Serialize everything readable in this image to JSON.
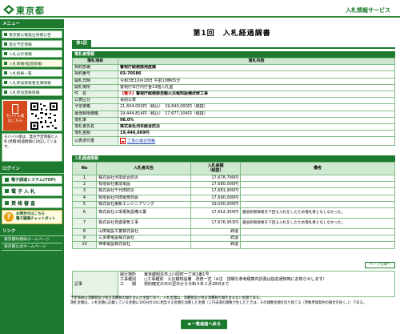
{
  "header": {
    "logo_text": "東京都",
    "service_title": "入札情報サービス"
  },
  "sidebar": {
    "menu_heading": "メニュー",
    "items": [
      {
        "label": "東京都公報発注情報公告",
        "selected": false
      },
      {
        "label": "発注予定情報",
        "selected": false
      },
      {
        "label": "入札公示情報",
        "selected": false
      },
      {
        "label": "入札情報(経過情報)",
        "selected": true
      },
      {
        "label": "入札結果一覧",
        "selected": false
      },
      {
        "label": "入札参加資格者名簿情報",
        "selected": false
      },
      {
        "label": "入札参加資格情報",
        "selected": false
      }
    ],
    "mobile_label": "モバイル版",
    "mobile_sub": "はこちら",
    "mobile_note": "モバイル版は、発注予定情報と入札(見積)経過情報に対応しています。",
    "links_heading": "ログイン",
    "links": [
      {
        "label": "電子調達システム(TOP)",
        "big": false
      },
      {
        "label": "電子入札",
        "big": true
      },
      {
        "label": "資格審査",
        "big": true
      }
    ],
    "help_title": "お問合せはこちら",
    "help_sub": "電子調達チャットボット",
    "plain_heading": "リンク",
    "plain_links": [
      "東京都財務局ホームページ",
      "東京都公式ホームページ"
    ]
  },
  "main": {
    "page_title": "第1回　入札経過調書",
    "tab_label": "第1回"
  },
  "overview": {
    "section_title": "落札者情報",
    "col_item": "落札項目",
    "col_content": "落札内容",
    "rows": [
      {
        "label": "契約部署",
        "value": "警視庁総務部用度課",
        "bold": true
      },
      {
        "label": "契約番号",
        "value": "03-70586",
        "bold": true
      },
      {
        "label": "開札日時",
        "value": "令和3年10月18日 午前10時05分",
        "bold": false
      },
      {
        "label": "開札場所",
        "value": "警視庁本庁内庁舎13階入札室",
        "bold": false
      },
      {
        "label": "件　名",
        "tag": "【電子】",
        "value": "警視庁総務部自動火災報知設備改修工事",
        "bold": true
      },
      {
        "label": "公表区分",
        "value": "事前公表",
        "bold": false
      },
      {
        "label": "予定価格",
        "value": "21,604,000円（税込）　19,640,000円（税抜）",
        "bold": false
      },
      {
        "label": "最低制限価格",
        "value": "19,444,814円（税込）　17,677,104円（税抜）",
        "bold": false
      },
      {
        "label": "落札率",
        "value": "98.0%",
        "bold": true
      },
      {
        "label": "落札者氏名",
        "value": "株式会社河本総合防災",
        "bold": true
      },
      {
        "label": "落札金額",
        "value": "19,446,669円",
        "bold": true
      }
    ],
    "doc_label": "公表添付書",
    "doc_link": "工事の場合情報"
  },
  "progress": {
    "section_title": "入札経過情報",
    "col_no": "No",
    "col_name": "入札者氏名",
    "col_amount": "入札金額\n（税抜）",
    "col_note": "備考",
    "rows": [
      {
        "no": "1",
        "name": "株式会社河本総合防災",
        "amount": "17,678,790円",
        "note": ""
      },
      {
        "no": "2",
        "name": "有限会社東成電設",
        "amount": "17,680,000円",
        "note": ""
      },
      {
        "no": "3",
        "name": "株式会社千代田防災",
        "amount": "17,681,900円",
        "note": ""
      },
      {
        "no": "4",
        "name": "有限会社内田電気商会",
        "amount": "17,690,000円",
        "note": ""
      },
      {
        "no": "5",
        "name": "株式会社東新エンジニアリング",
        "amount": "19,000,000円",
        "note": ""
      },
      {
        "no": "6",
        "name": "株式会社三栄電気設備工業",
        "amount": "17,652,350円",
        "note": "最低制限価格を下回る入札をしたため落札者となしなかった。"
      },
      {
        "no": "7",
        "name": "株式会社見盛電気工事",
        "amount": "17,676,953円",
        "note": "最低制限価格を下回る入札をしたため落札者となしなかった。"
      },
      {
        "no": "8",
        "name": "山田電設工業株式会社",
        "amount": "辞退",
        "note": ""
      },
      {
        "no": "9",
        "name": "三多摩電設株式会社",
        "amount": "辞退",
        "note": ""
      },
      {
        "no": "10",
        "name": "神幸電設株式会社",
        "amount": "辞退",
        "note": ""
      }
    ],
    "to_top": "ページ先頭へ"
  },
  "remarks": {
    "label": "記事",
    "lines": [
      "履行場所　　東京都昭島市上川原町一丁目1番1号",
      "工事種別　　○工事種別　火災報知設備　改修一式（※注　詳細な参考積算内訳書は指名通知時にお知らせします）",
      "工　　期　　契約確定の日の翌日から令和４年２月28日まで"
    ]
  },
  "footnotes": [
    "予定価格は消費税及び地方消費税の額を含んだ金額であり、入札金額は、消費税及び地方消費税の額を含まない金額である。",
    "落札金額は、入札金額に記載している金額に100分の10に相当する金額を加算した金額（１円未満の端数が生じたときは、その端数金額を切り捨てる（単数単価契約の場合を除く。））である。"
  ],
  "back_button": "一覧画面へ戻る"
}
